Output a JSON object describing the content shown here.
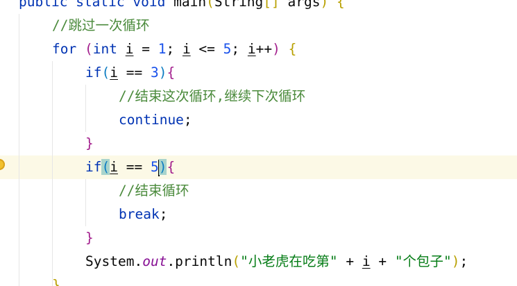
{
  "code": {
    "l1": {
      "kw1": "public",
      "kw2": "static",
      "kw3": "void",
      "fn": "main",
      "open": "(",
      "type": "String",
      "brackets": "[]",
      "param": "args",
      "close": ")",
      "brace": "{"
    },
    "l2": {
      "comment": "//跳过一次循环"
    },
    "l3": {
      "kw_for": "for",
      "open": "(",
      "kw_int": "int",
      "var1": "i",
      "assign": " = ",
      "n1": "1",
      "semi1": "; ",
      "var2": "i",
      "le": " <= ",
      "n5": "5",
      "semi2": "; ",
      "var3": "i",
      "inc": "++",
      "close": ")",
      "brace": "{"
    },
    "l4": {
      "kw_if": "if",
      "open": "(",
      "var": "i",
      "eq": " == ",
      "n": "3",
      "close": ")",
      "brace": "{"
    },
    "l5": {
      "comment": "//结束这次循环,继续下次循环"
    },
    "l6": {
      "kw": "continue",
      "semi": ";"
    },
    "l7": {
      "brace": "}"
    },
    "l8": {
      "kw_if": "if",
      "open": "(",
      "var": "i",
      "eq": " == ",
      "n": "5",
      "close": ")",
      "brace": "{"
    },
    "l9": {
      "comment": "//结束循环"
    },
    "l10": {
      "kw": "break",
      "semi": ";"
    },
    "l11": {
      "brace": "}"
    },
    "l12": {
      "cls": "System",
      "dot1": ".",
      "field": "out",
      "dot2": ".println",
      "open": "(",
      "s1": "\"小老虎在吃第\"",
      "plus1": " + ",
      "var": "i",
      "plus2": " + ",
      "s2": "\"个包子\"",
      "close": ")",
      "semi": ";"
    },
    "l13": {
      "brace": "}"
    }
  }
}
